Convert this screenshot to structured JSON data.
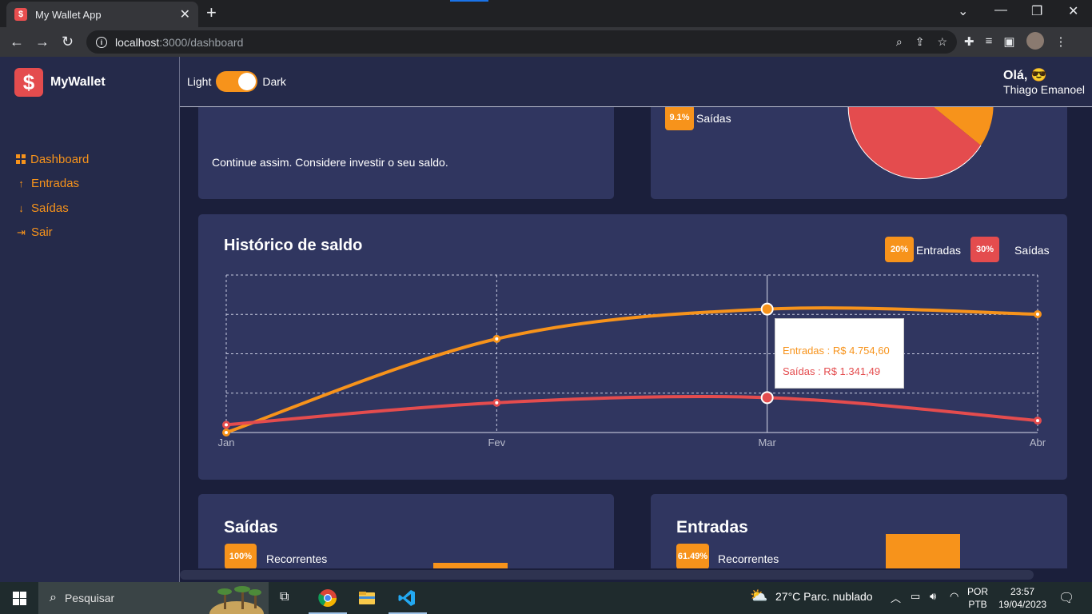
{
  "browser": {
    "tab_title": "My Wallet App",
    "tab_favicon": "$",
    "url_host": "localhost",
    "url_path": ":3000/dashboard"
  },
  "app": {
    "brand": "MyWallet",
    "brand_logo": "$",
    "theme_toggle": {
      "light": "Light",
      "dark": "Dark",
      "state": "dark"
    },
    "greeting": {
      "hello": "Olá, 😎",
      "name": "Thiago Emanoel"
    },
    "menu": [
      {
        "label": "Dashboard",
        "icon": "grid-icon"
      },
      {
        "label": "Entradas",
        "icon": "arrow-up-icon"
      },
      {
        "label": "Saídas",
        "icon": "arrow-down-icon"
      },
      {
        "label": "Sair",
        "icon": "exit-icon"
      }
    ],
    "tip_card": {
      "message": "Continue assim. Considere investir o seu saldo."
    },
    "pie_card": {
      "badge": "9.1%",
      "label": "Saídas"
    },
    "history": {
      "title": "Histórico de saldo",
      "legend": [
        {
          "badge": "20%",
          "label": "Entradas",
          "color": "#f7931b"
        },
        {
          "badge": "30%",
          "label": "Saídas",
          "color": "#e44c4e"
        }
      ],
      "tooltip": {
        "entradas": "Entradas : R$ 4.754,60",
        "saidas": "Saídas : R$ 1.341,49"
      }
    },
    "saidas_card": {
      "title": "Saídas",
      "badge": "100%",
      "label": "Recorrentes"
    },
    "entradas_card": {
      "title": "Entradas",
      "badge": "61.49%",
      "label": "Recorrentes"
    }
  },
  "chart_data": {
    "type": "line",
    "categories": [
      "Jan",
      "Fev",
      "Mar",
      "Abr"
    ],
    "series": [
      {
        "name": "Entradas",
        "color": "#f7931b",
        "values": [
          0,
          2200,
          2900,
          2780
        ]
      },
      {
        "name": "Saídas",
        "color": "#e44c4e",
        "values": [
          180,
          700,
          820,
          280
        ]
      }
    ],
    "ylim": [
      0,
      3700
    ],
    "grid": true,
    "active_category": "Mar"
  },
  "taskbar": {
    "search_placeholder": "Pesquisar",
    "weather": "27°C  Parc. nublado",
    "lang_line1": "POR",
    "lang_line2": "PTB",
    "time": "23:57",
    "date": "19/04/2023"
  },
  "colors": {
    "accent": "#f7931b",
    "danger": "#e44c4e",
    "background": "#1b1f3b",
    "card": "#303660"
  }
}
